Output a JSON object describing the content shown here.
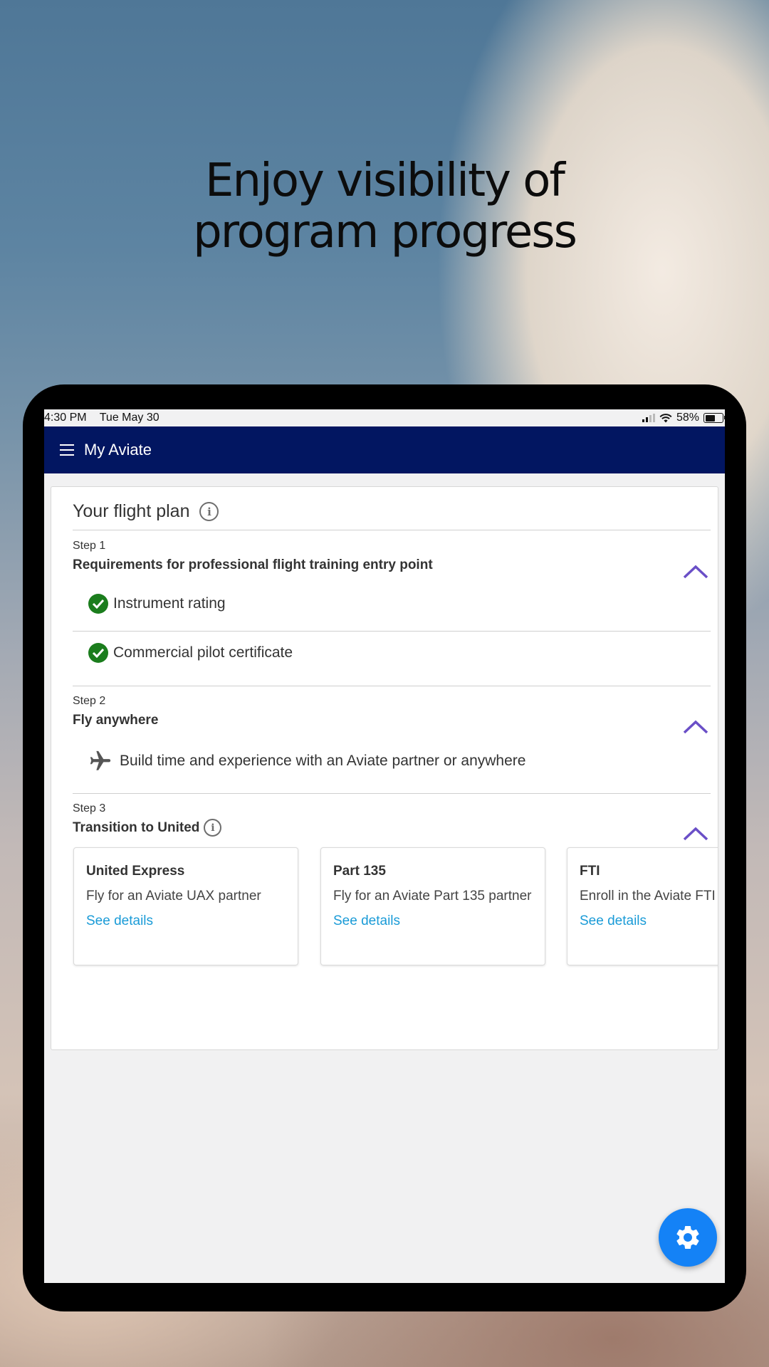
{
  "headline": {
    "line1": "Enjoy visibility of",
    "line2": "program progress"
  },
  "status_bar": {
    "time": "4:30 PM",
    "date": "Tue May 30",
    "battery": "58%"
  },
  "app_bar": {
    "title": "My Aviate",
    "menu_icon": "hamburger-menu-icon"
  },
  "flight_plan": {
    "title": "Your flight plan",
    "steps": [
      {
        "number": "Step 1",
        "title": "Requirements for professional flight training entry point",
        "items": [
          {
            "label": "Instrument rating",
            "icon": "check-circle-icon",
            "status": "complete"
          },
          {
            "label": "Commercial pilot certificate",
            "icon": "check-circle-icon",
            "status": "complete"
          }
        ]
      },
      {
        "number": "Step 2",
        "title": "Fly anywhere",
        "items": [
          {
            "label": "Build time and experience with an Aviate partner or anywhere",
            "icon": "airplane-icon"
          }
        ]
      },
      {
        "number": "Step 3",
        "title": "Transition to United",
        "options": [
          {
            "title": "United Express",
            "description": "Fly for an Aviate UAX partner",
            "link": "See details"
          },
          {
            "title": "Part 135",
            "description": "Fly for an Aviate Part 135 partner",
            "link": "See details"
          },
          {
            "title": "FTI",
            "description": "Enroll in the Aviate FTI program",
            "link": "See details"
          }
        ]
      }
    ]
  },
  "colors": {
    "app_bar": "#021661",
    "check": "#1b7d1d",
    "chevron": "#6a4fc7",
    "link": "#1a9bd7",
    "fab": "#1482f6"
  },
  "fab": {
    "icon": "gear-icon"
  }
}
